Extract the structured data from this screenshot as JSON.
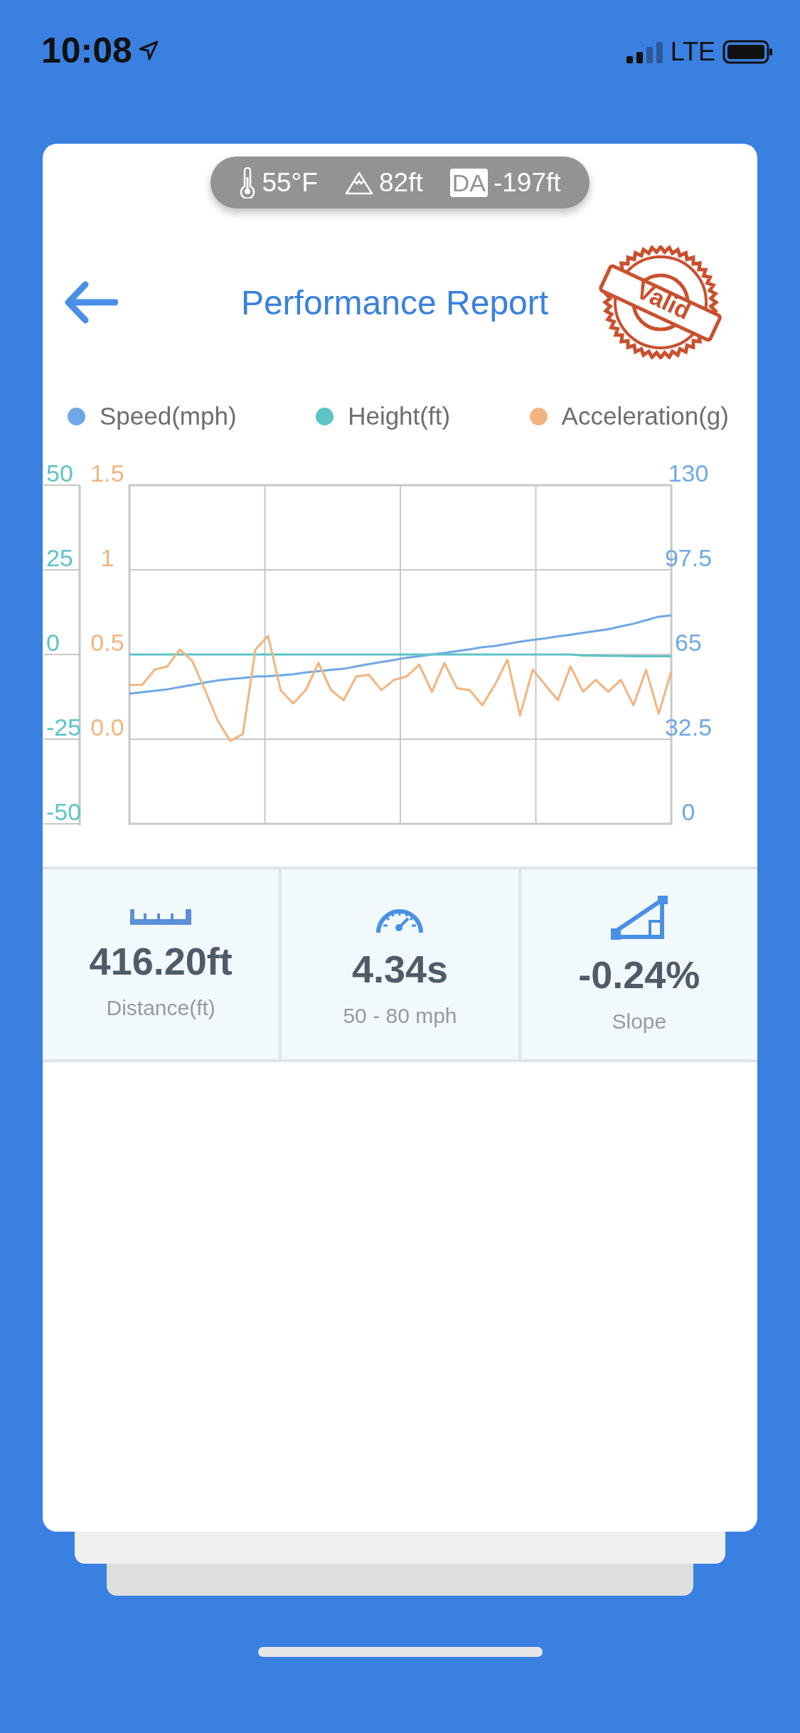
{
  "status_bar": {
    "time": "10:08",
    "network": "LTE"
  },
  "conditions": [
    {
      "kind": "temperature",
      "text": "55°F"
    },
    {
      "kind": "altitude",
      "text": "82ft"
    },
    {
      "kind": "density_altitude",
      "badge": "DA",
      "text": "-197ft"
    }
  ],
  "header": {
    "title": "Performance Report",
    "stamp": "Valid"
  },
  "chart": {
    "chart_data": {
      "type": "line",
      "grid": true,
      "ylim": [
        -50,
        50
      ],
      "yticks": [
        50,
        25,
        0,
        -25,
        -50
      ],
      "y2lim": [
        -0.5,
        1.5
      ],
      "y2ticks": [
        1.5,
        1,
        0.5,
        {
          "value": 0,
          "label": "0.0"
        }
      ],
      "y3lim": [
        0,
        130
      ],
      "y3ticks": [
        130,
        97.5,
        65,
        32.5,
        0
      ],
      "series": [
        {
          "name": "Speed(mph)",
          "color": "#6fa8e6",
          "axis": "y3",
          "values": [
            50,
            50.5,
            51.1,
            51.6,
            52.5,
            53.3,
            54.2,
            55,
            55.6,
            56,
            56.5,
            56.7,
            57,
            57.4,
            58.1,
            58.6,
            59.1,
            59.5,
            60.4,
            61.3,
            62.1,
            62.9,
            63.8,
            64.3,
            65,
            65.6,
            66.3,
            67,
            67.8,
            68.3,
            69.1,
            69.9,
            70.6,
            71.2,
            72,
            72.6,
            73.3,
            74,
            74.7,
            75.8,
            76.8,
            78.2,
            79.5,
            80
          ]
        },
        {
          "name": "Height(ft)",
          "color": "#5cc3c6",
          "values": [
            0,
            0,
            0,
            0,
            0,
            0,
            0,
            0,
            0,
            0,
            0,
            0,
            0,
            0,
            0,
            0,
            0,
            0,
            0,
            0,
            0,
            0,
            0,
            0,
            0,
            0,
            0,
            0,
            0,
            0,
            0,
            0,
            0,
            0,
            0,
            0,
            -0.3,
            -0.3,
            -0.4,
            -0.4,
            -0.5,
            -0.5,
            -0.5,
            -0.5
          ]
        },
        {
          "name": "Acceleration(g)",
          "color": "#f3b47f",
          "axis": "y2",
          "values": [
            0.32,
            0.32,
            0.41,
            0.43,
            0.53,
            0.46,
            0.29,
            0.11,
            -0.01,
            0.03,
            0.53,
            0.61,
            0.29,
            0.21,
            0.29,
            0.45,
            0.29,
            0.23,
            0.37,
            0.38,
            0.29,
            0.35,
            0.37,
            0.44,
            0.28,
            0.45,
            0.3,
            0.29,
            0.2,
            0.32,
            0.47,
            0.14,
            0.41,
            0.32,
            0.23,
            0.43,
            0.28,
            0.35,
            0.28,
            0.35,
            0.2,
            0.41,
            0.15,
            0.4
          ]
        }
      ]
    }
  },
  "stats": [
    {
      "kind": "distance",
      "value": "416.20ft",
      "label": "Distance(ft)"
    },
    {
      "kind": "time",
      "value": "4.34s",
      "label": "50 - 80 mph"
    },
    {
      "kind": "slope",
      "value": "-0.24%",
      "label": "Slope"
    }
  ]
}
